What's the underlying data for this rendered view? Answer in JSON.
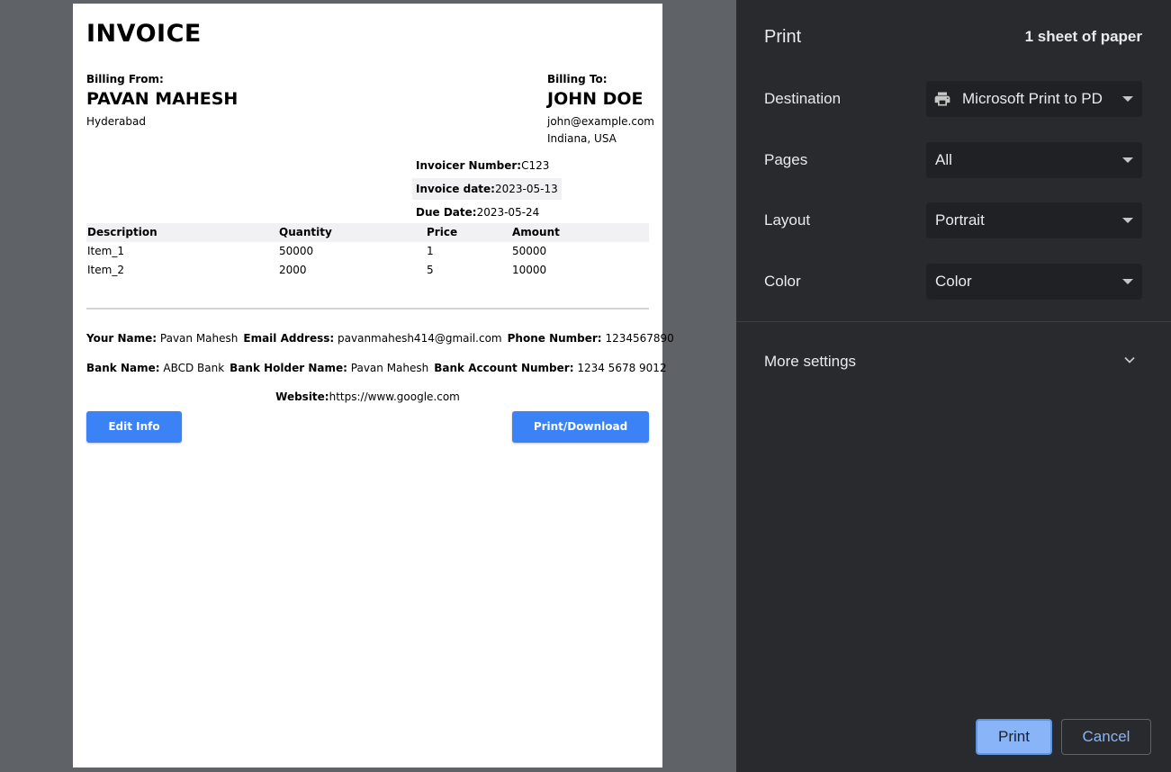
{
  "invoice": {
    "title": "INVOICE",
    "billing_from": {
      "label": "Billing From:",
      "name": "PAVAN MAHESH",
      "city": "Hyderabad"
    },
    "billing_to": {
      "label": "Billing To:",
      "name": "JOHN DOE",
      "email": "john@example.com",
      "address": "Indiana, USA"
    },
    "meta": [
      {
        "label": "Invoicer Number:",
        "value": "C123"
      },
      {
        "label": "Invoice date:",
        "value": "2023-05-13"
      },
      {
        "label": "Due Date:",
        "value": "2023-05-24"
      }
    ],
    "table": {
      "headers": [
        "Description",
        "Quantity",
        "Price",
        "Amount"
      ],
      "rows": [
        [
          "Item_1",
          "50000",
          "1",
          "50000"
        ],
        [
          "Item_2",
          "2000",
          "5",
          "10000"
        ]
      ]
    },
    "contact": {
      "your_name_label": "Your Name:",
      "your_name": "Pavan Mahesh",
      "email_label": "Email Address:",
      "email": "pavanmahesh414@gmail.com",
      "phone_label": "Phone Number:",
      "phone": "1234567890",
      "bank_label": "Bank Name:",
      "bank": "ABCD Bank",
      "holder_label": "Bank Holder Name:",
      "holder": "Pavan Mahesh",
      "account_label": "Bank Account Number:",
      "account": "1234 5678 9012",
      "website_label": "Website:",
      "website": "https://www.google.com"
    },
    "buttons": {
      "edit": "Edit Info",
      "download": "Print/Download"
    }
  },
  "print_panel": {
    "title": "Print",
    "sheets": "1 sheet of paper",
    "destination": {
      "label": "Destination",
      "value": "Microsoft Print to PD",
      "icon": "printer-icon"
    },
    "pages": {
      "label": "Pages",
      "value": "All"
    },
    "layout": {
      "label": "Layout",
      "value": "Portrait"
    },
    "color": {
      "label": "Color",
      "value": "Color"
    },
    "more_settings": "More settings",
    "print_button": "Print",
    "cancel_button": "Cancel"
  },
  "colors": {
    "accent_blue": "#3b82f6",
    "panel_bg": "#292a2d",
    "print_btn": "#8ab4f8"
  }
}
